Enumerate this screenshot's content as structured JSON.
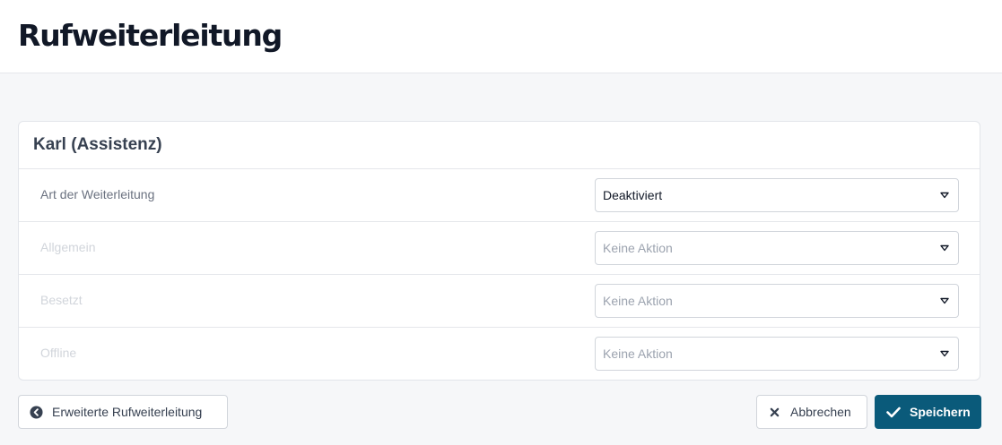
{
  "header": {
    "title": "Rufweiterleitung"
  },
  "card": {
    "title": "Karl (Assistenz)",
    "rows": [
      {
        "label": "Art der Weiterleitung",
        "value": "Deaktiviert",
        "enabled": true
      },
      {
        "label": "Allgemein",
        "value": "Keine Aktion",
        "enabled": false
      },
      {
        "label": "Besetzt",
        "value": "Keine Aktion",
        "enabled": false
      },
      {
        "label": "Offline",
        "value": "Keine Aktion",
        "enabled": false
      }
    ]
  },
  "footer": {
    "advanced_label": "Erweiterte Rufweiterleitung",
    "cancel_label": "Abbrechen",
    "save_label": "Speichern"
  },
  "icons": {
    "advanced": "arrow-left-circle-icon",
    "cancel": "close-icon",
    "save": "check-icon",
    "select": "caret-down-icon"
  },
  "colors": {
    "primary": "#0a5a7a",
    "disabled_text": "#d1d5db"
  }
}
